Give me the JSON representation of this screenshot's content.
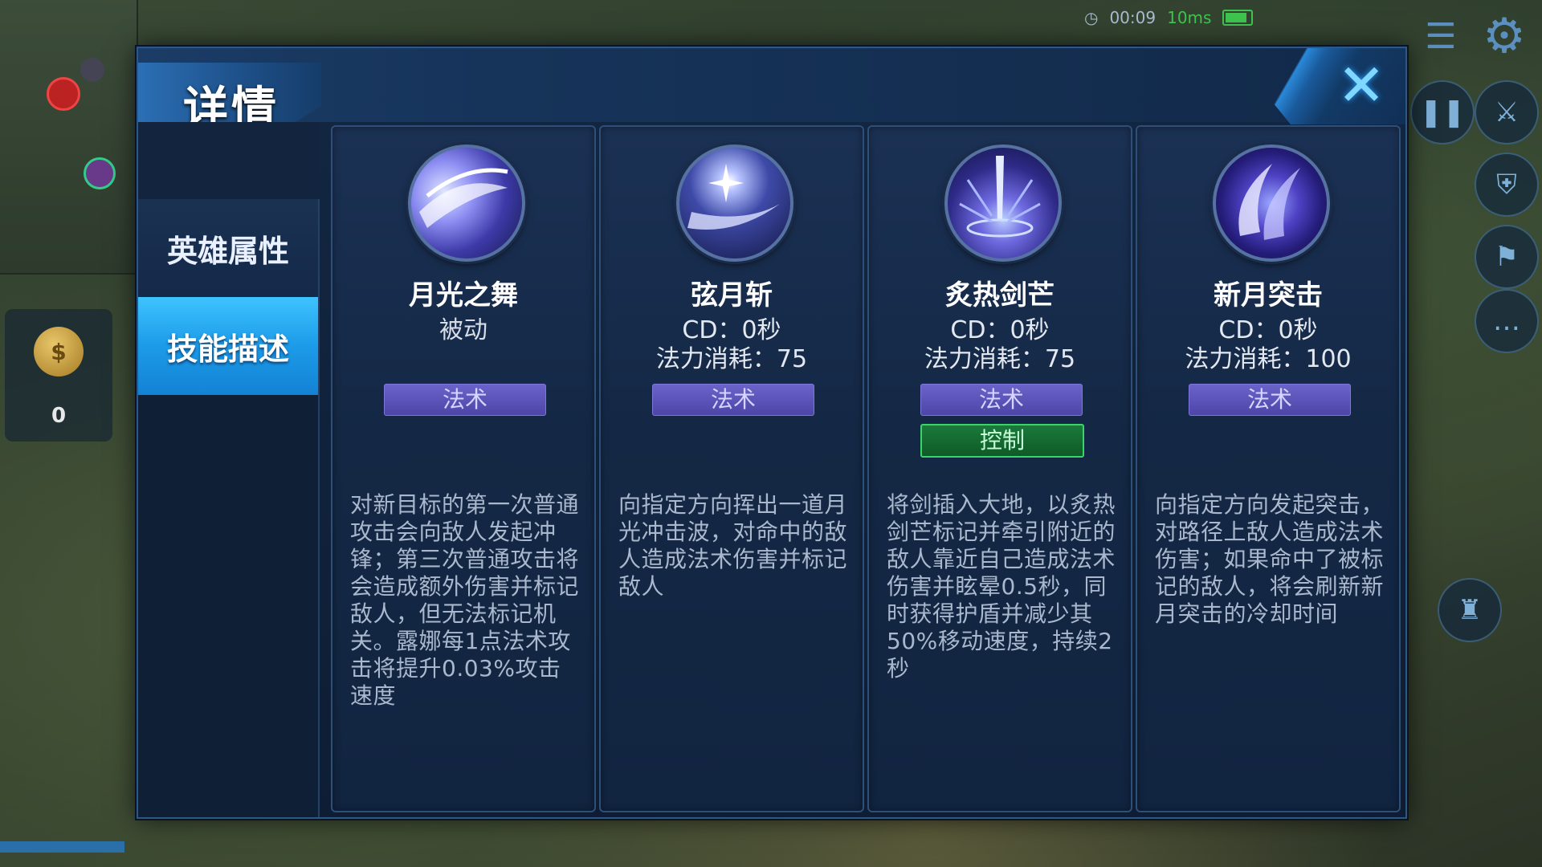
{
  "hud": {
    "timer": "00:09",
    "ping": "10ms",
    "gold_count": "0"
  },
  "modal": {
    "title": "详情",
    "close_label": "✕"
  },
  "sidebar": {
    "items": [
      {
        "label": "英雄属性",
        "active": false
      },
      {
        "label": "技能描述",
        "active": true
      }
    ]
  },
  "skills": [
    {
      "name": "月光之舞",
      "line1": "被动",
      "line2": "",
      "tags": [
        "法术"
      ],
      "description": "对新目标的第一次普通攻击会向敌人发起冲锋；第三次普通攻击将会造成额外伤害并标记敌人，但无法标记机关。露娜每1点法术攻击将提升0.03%攻击速度",
      "icon": "moon-dance-icon"
    },
    {
      "name": "弦月斩",
      "line1": "CD：0秒",
      "line2": "法力消耗：75",
      "tags": [
        "法术"
      ],
      "description": "向指定方向挥出一道月光冲击波，对命中的敌人造成法术伤害并标记敌人",
      "icon": "crescent-slash-icon"
    },
    {
      "name": "炙热剑芒",
      "line1": "CD：0秒",
      "line2": "法力消耗：75",
      "tags": [
        "法术",
        "控制"
      ],
      "description": "将剑插入大地，以炙热剑芒标记并牵引附近的敌人靠近自己造成法术伤害并眩晕0.5秒，同时获得护盾并减少其50%移动速度，持续2秒",
      "icon": "blazing-sword-icon"
    },
    {
      "name": "新月突击",
      "line1": "CD：0秒",
      "line2": "法力消耗：100",
      "tags": [
        "法术"
      ],
      "description": "向指定方向发起突击，对路径上敌人造成法术伤害；如果命中了被标记的敌人，将会刷新新月突击的冷却时间",
      "icon": "new-moon-strike-icon"
    }
  ],
  "colors": {
    "modal_bg": "#132743",
    "active_tab": "#1c9be8",
    "magic_tag": "#5b54b8",
    "control_tag": "#1a7a3a"
  }
}
